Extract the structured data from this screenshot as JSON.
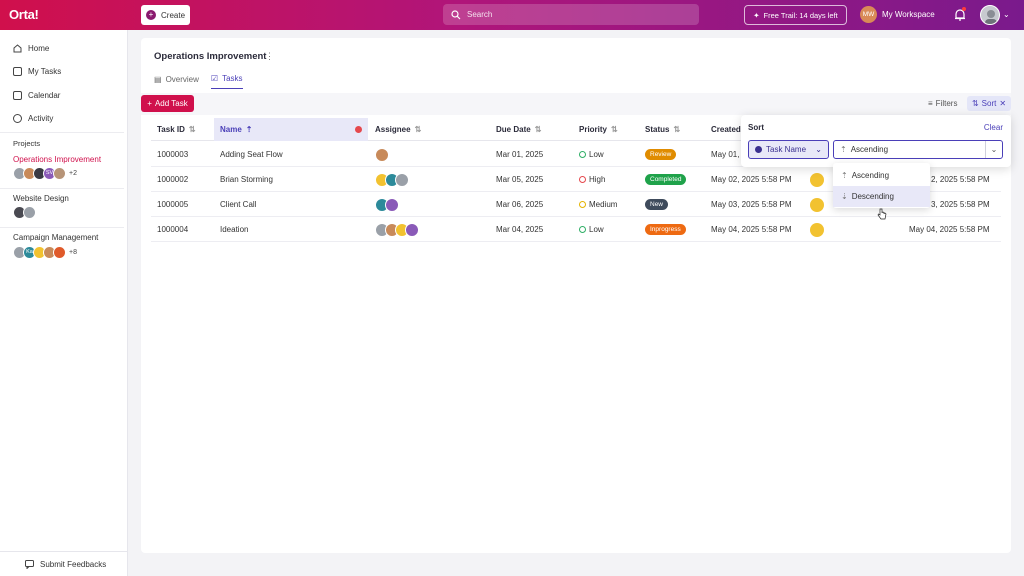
{
  "app": {
    "logo": "Orta!"
  },
  "header": {
    "create_label": "Create",
    "search_placeholder": "Search",
    "trial_label": "Free Trail: 14 days left",
    "workspace_initials": "MW",
    "workspace_label": "My Workspace"
  },
  "sidebar": {
    "nav": [
      "Home",
      "My Tasks",
      "Calendar",
      "Activity"
    ],
    "projects_title": "Projects",
    "projects": [
      {
        "name": "Operations Improvement",
        "avatar_text": "SV",
        "more": "+2"
      },
      {
        "name": "Website Design"
      },
      {
        "name": "Campaign Management",
        "avatar_text": "Ka",
        "more": "+8"
      }
    ],
    "feedback_label": "Submit Feedbacks"
  },
  "main": {
    "title": "Operations Improvement",
    "tabs": [
      "Overview",
      "Tasks"
    ],
    "add_task_label": "Add Task",
    "filters_label": "Filters",
    "sort_label": "Sort"
  },
  "table": {
    "columns": [
      "Task ID",
      "Name",
      "Assignee",
      "Due Date",
      "Priority",
      "Status",
      "Created"
    ],
    "rows": [
      {
        "id": "1000003",
        "name": "Adding Seat Flow",
        "due": "Mar 01, 2025",
        "priority": "Low",
        "status": "Review",
        "created": "May 01,",
        "updated": ""
      },
      {
        "id": "1000002",
        "name": "Brian Storming",
        "due": "Mar 05, 2025",
        "priority": "High",
        "status": "Completed",
        "created": "May 02, 2025 5:58 PM",
        "updated": "2, 2025 5:58 PM"
      },
      {
        "id": "1000005",
        "name": "Client Call",
        "due": "Mar 06, 2025",
        "priority": "Medium",
        "status": "New",
        "created": "May 03, 2025 5:58 PM",
        "updated": "3, 2025 5:58 PM"
      },
      {
        "id": "1000004",
        "name": "Ideation",
        "due": "Mar 04, 2025",
        "priority": "Low",
        "status": "Inprogress",
        "created": "May 04, 2025 5:58 PM",
        "updated": "May 04, 2025 5:58 PM"
      }
    ]
  },
  "sort_popover": {
    "title": "Sort",
    "clear_label": "Clear",
    "field_label": "Task Name",
    "order_value": "Ascending",
    "options": [
      "Ascending",
      "Descending"
    ]
  },
  "colors": {
    "brand": "#d0104c",
    "accent": "#4a3fb8",
    "review": "#e08c00",
    "completed": "#1fa24a",
    "new": "#3f4b5c",
    "inprogress": "#ee6a12",
    "low": "#2fae66",
    "high": "#e5484d",
    "medium": "#e5b400"
  }
}
